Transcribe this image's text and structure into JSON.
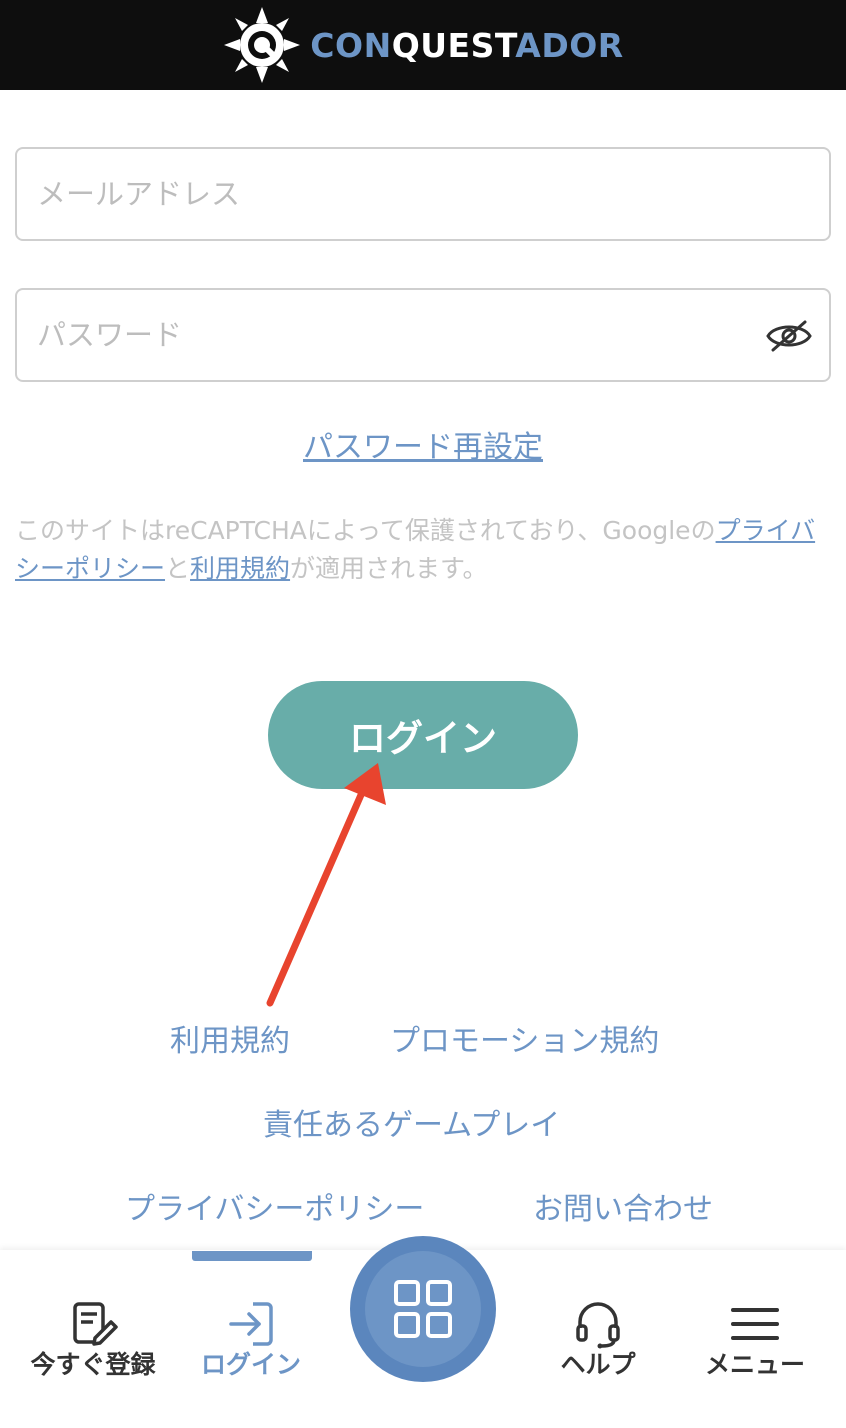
{
  "header": {
    "brand_part1": "CON",
    "brand_part2": "QUEST",
    "brand_part3": "ADOR"
  },
  "form": {
    "email_placeholder": "メールアドレス",
    "password_placeholder": "パスワード",
    "reset_link": "パスワード再設定"
  },
  "recaptcha": {
    "text_before": "このサイトはreCAPTCHAによって保護されており、Googleの",
    "privacy_link": "プライバシーポリシー",
    "connector": "と",
    "terms_link": "利用規約",
    "text_after": "が適用されます。"
  },
  "login_button": "ログイン",
  "footer_links": {
    "terms": "利用規約",
    "promo_terms": "プロモーション規約",
    "responsible": "責任あるゲームプレイ",
    "privacy": "プライバシーポリシー",
    "contact": "お問い合わせ"
  },
  "bottom_nav": {
    "register": "今すぐ登録",
    "login": "ログイン",
    "help": "ヘルプ",
    "menu": "メニュー"
  },
  "icons": {
    "logo": "compass-q-logo-icon",
    "password_toggle": "eye-off-icon",
    "register": "edit-document-icon",
    "login": "login-arrow-icon",
    "center": "grid-icon",
    "help": "headset-icon",
    "menu": "hamburger-menu-icon"
  },
  "colors": {
    "header_bg": "#0e0e0e",
    "accent_blue": "#6d95c6",
    "login_button": "#68ada9",
    "annotation_arrow": "#e8442e"
  }
}
